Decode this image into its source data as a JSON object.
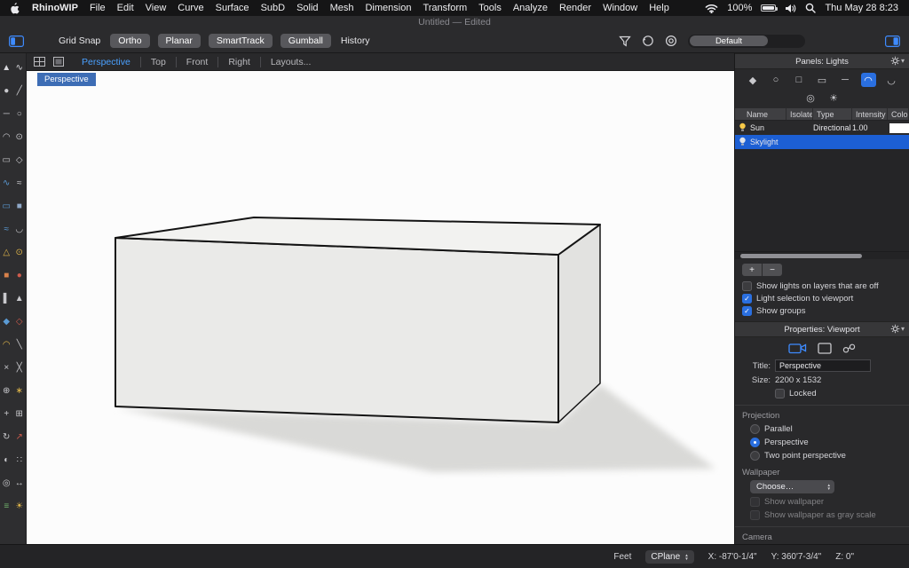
{
  "menubar": {
    "app_name": "RhinoWIP",
    "items": [
      {
        "name": "menu-file",
        "label": "File"
      },
      {
        "name": "menu-edit",
        "label": "Edit"
      },
      {
        "name": "menu-view",
        "label": "View"
      },
      {
        "name": "menu-curve",
        "label": "Curve"
      },
      {
        "name": "menu-surface",
        "label": "Surface"
      },
      {
        "name": "menu-subd",
        "label": "SubD"
      },
      {
        "name": "menu-solid",
        "label": "Solid"
      },
      {
        "name": "menu-mesh",
        "label": "Mesh"
      },
      {
        "name": "menu-dimension",
        "label": "Dimension"
      },
      {
        "name": "menu-transform",
        "label": "Transform"
      },
      {
        "name": "menu-tools",
        "label": "Tools"
      },
      {
        "name": "menu-analyze",
        "label": "Analyze"
      },
      {
        "name": "menu-render",
        "label": "Render"
      },
      {
        "name": "menu-window",
        "label": "Window"
      },
      {
        "name": "menu-help",
        "label": "Help"
      }
    ],
    "battery": "100%",
    "clock": "Thu May 28  8:23"
  },
  "titlebar": {
    "title": "Untitled — Edited"
  },
  "toolbar": {
    "grid_snap": "Grid Snap",
    "toggles": [
      {
        "name": "ortho-toggle",
        "label": "Ortho"
      },
      {
        "name": "planar-toggle",
        "label": "Planar"
      },
      {
        "name": "smarttrack-toggle",
        "label": "SmartTrack"
      },
      {
        "name": "gumball-toggle",
        "label": "Gumball"
      }
    ],
    "history": "History",
    "display_mode": "Default"
  },
  "view_tabs": [
    "Perspective",
    "Top",
    "Front",
    "Right",
    "Layouts..."
  ],
  "viewport": {
    "label": "Perspective"
  },
  "sidebar": {
    "tools": [
      {
        "name": "select-tool-icon",
        "g": "▲",
        "c": "#d8d8dc"
      },
      {
        "name": "lasso-select-tool-icon",
        "g": "∿",
        "c": "#d8d8dc"
      },
      {
        "name": "point-tool-icon",
        "g": "●",
        "c": "#c9c9cd"
      },
      {
        "name": "polyline-tool-icon",
        "g": "╱",
        "c": "#c9c9cd"
      },
      {
        "name": "line-tool-icon",
        "g": "─",
        "c": "#c9c9cd"
      },
      {
        "name": "circle-tool-icon",
        "g": "○",
        "c": "#c9c9cd"
      },
      {
        "name": "arc-tool-icon",
        "g": "◠",
        "c": "#c9c9cd"
      },
      {
        "name": "ellipse-tool-icon",
        "g": "⊙",
        "c": "#c9c9cd"
      },
      {
        "name": "rectangle-tool-icon",
        "g": "▭",
        "c": "#c9c9cd"
      },
      {
        "name": "polygon-tool-icon",
        "g": "◇",
        "c": "#c9c9cd"
      },
      {
        "name": "curve-tool-icon",
        "g": "∿",
        "c": "#5b9bd5"
      },
      {
        "name": "interpolate-curve-tool-icon",
        "g": "≈",
        "c": "#c9c9cd"
      },
      {
        "name": "surface-tool-icon",
        "g": "▭",
        "c": "#5b9bd5"
      },
      {
        "name": "plane-tool-icon",
        "g": "■",
        "c": "#8fa8c8"
      },
      {
        "name": "loft-tool-icon",
        "g": "≈",
        "c": "#5b9bd5"
      },
      {
        "name": "sweep-tool-icon",
        "g": "◡",
        "c": "#c9c9cd"
      },
      {
        "name": "extrude-tool-icon",
        "g": "△",
        "c": "#e0b64a"
      },
      {
        "name": "revolve-tool-icon",
        "g": "⊙",
        "c": "#e0b64a"
      },
      {
        "name": "box-tool-icon",
        "g": "■",
        "c": "#d9824b"
      },
      {
        "name": "sphere-tool-icon",
        "g": "●",
        "c": "#cf5b4c"
      },
      {
        "name": "cylinder-tool-icon",
        "g": "▌",
        "c": "#c9c9cd"
      },
      {
        "name": "cone-tool-icon",
        "g": "▲",
        "c": "#c9c9cd"
      },
      {
        "name": "boolean-union-tool-icon",
        "g": "◆",
        "c": "#5b9bd5"
      },
      {
        "name": "boolean-difference-tool-icon",
        "g": "◇",
        "c": "#cf5b4c"
      },
      {
        "name": "fillet-tool-icon",
        "g": "◠",
        "c": "#e0b64a"
      },
      {
        "name": "chamfer-tool-icon",
        "g": "╲",
        "c": "#c9c9cd"
      },
      {
        "name": "trim-tool-icon",
        "g": "×",
        "c": "#c9c9cd"
      },
      {
        "name": "split-tool-icon",
        "g": "╳",
        "c": "#c9c9cd"
      },
      {
        "name": "join-tool-icon",
        "g": "⊕",
        "c": "#c9c9cd"
      },
      {
        "name": "explode-tool-icon",
        "g": "∗",
        "c": "#e0b64a"
      },
      {
        "name": "move-tool-icon",
        "g": "+",
        "c": "#c9c9cd"
      },
      {
        "name": "copy-tool-icon",
        "g": "⊞",
        "c": "#c9c9cd"
      },
      {
        "name": "rotate-tool-icon",
        "g": "↻",
        "c": "#c9c9cd"
      },
      {
        "name": "scale-tool-icon",
        "g": "↗",
        "c": "#cf5b4c"
      },
      {
        "name": "mirror-tool-icon",
        "g": "◐",
        "c": "#c9c9cd"
      },
      {
        "name": "array-tool-icon",
        "g": "∷",
        "c": "#c9c9cd"
      },
      {
        "name": "zoom-tool-icon",
        "g": "◎",
        "c": "#c9c9cd"
      },
      {
        "name": "pan-tool-icon",
        "g": "↔",
        "c": "#c9c9cd"
      },
      {
        "name": "layer-tool-icon",
        "g": "≡",
        "c": "#6fb06a"
      },
      {
        "name": "light-tool-icon",
        "g": "☀",
        "c": "#e0b64a"
      }
    ]
  },
  "lights_panel": {
    "title": "Panels: Lights",
    "light_type_icons": [
      {
        "name": "spotlight-icon",
        "g": "◆"
      },
      {
        "name": "point-light-icon",
        "g": "○"
      },
      {
        "name": "directional-light-icon",
        "g": "□"
      },
      {
        "name": "rectangular-light-icon",
        "g": "▭"
      },
      {
        "name": "linear-light-icon",
        "g": "─"
      },
      {
        "name": "skylight-icon",
        "g": "◠",
        "sel": true
      },
      {
        "name": "tube-light-icon",
        "g": "◡"
      },
      {
        "name": "dome-light-icon",
        "g": "◎"
      },
      {
        "name": "sun-icon",
        "g": "☀"
      }
    ],
    "columns": [
      "Name",
      "Isolate",
      "Type",
      "Intensity",
      "Color"
    ],
    "rows": [
      {
        "name": "Sun",
        "type": "Directional",
        "intensity": "1.00",
        "color": "#ffffff",
        "selected": false
      },
      {
        "name": "Skylight",
        "type": "",
        "intensity": "",
        "color": "",
        "selected": true
      }
    ],
    "add_label": "+",
    "remove_label": "−",
    "options": [
      {
        "label": "Show lights on layers that are off",
        "checked": false
      },
      {
        "label": "Light selection to viewport",
        "checked": true
      },
      {
        "label": "Show groups",
        "checked": true
      }
    ]
  },
  "properties_panel": {
    "title": "Properties: Viewport",
    "fields": {
      "title_label": "Title:",
      "title_value": "Perspective",
      "size_label": "Size:",
      "size_value": "2200 x 1532",
      "locked_label": "Locked"
    },
    "projection": {
      "heading": "Projection",
      "options": [
        {
          "label": "Parallel",
          "selected": false
        },
        {
          "label": "Perspective",
          "selected": true
        },
        {
          "label": "Two point perspective",
          "selected": false
        }
      ]
    },
    "wallpaper": {
      "heading": "Wallpaper",
      "choose_label": "Choose…",
      "options": [
        {
          "label": "Show wallpaper",
          "checked": false
        },
        {
          "label": "Show wallpaper as gray scale",
          "checked": false
        }
      ]
    },
    "camera_heading": "Camera"
  },
  "status_bar": {
    "units": "Feet",
    "cplane": "CPlane",
    "x": "X: -87'0-1/4\"",
    "y": "Y: 360'7-3/4\"",
    "z": "Z: 0\""
  },
  "colors": {
    "accent_blue": "#2a6fe0",
    "selection_row": "#1c5fd4",
    "viewport_chip": "#3d6db5",
    "sun_bulb": "#f7c948"
  }
}
